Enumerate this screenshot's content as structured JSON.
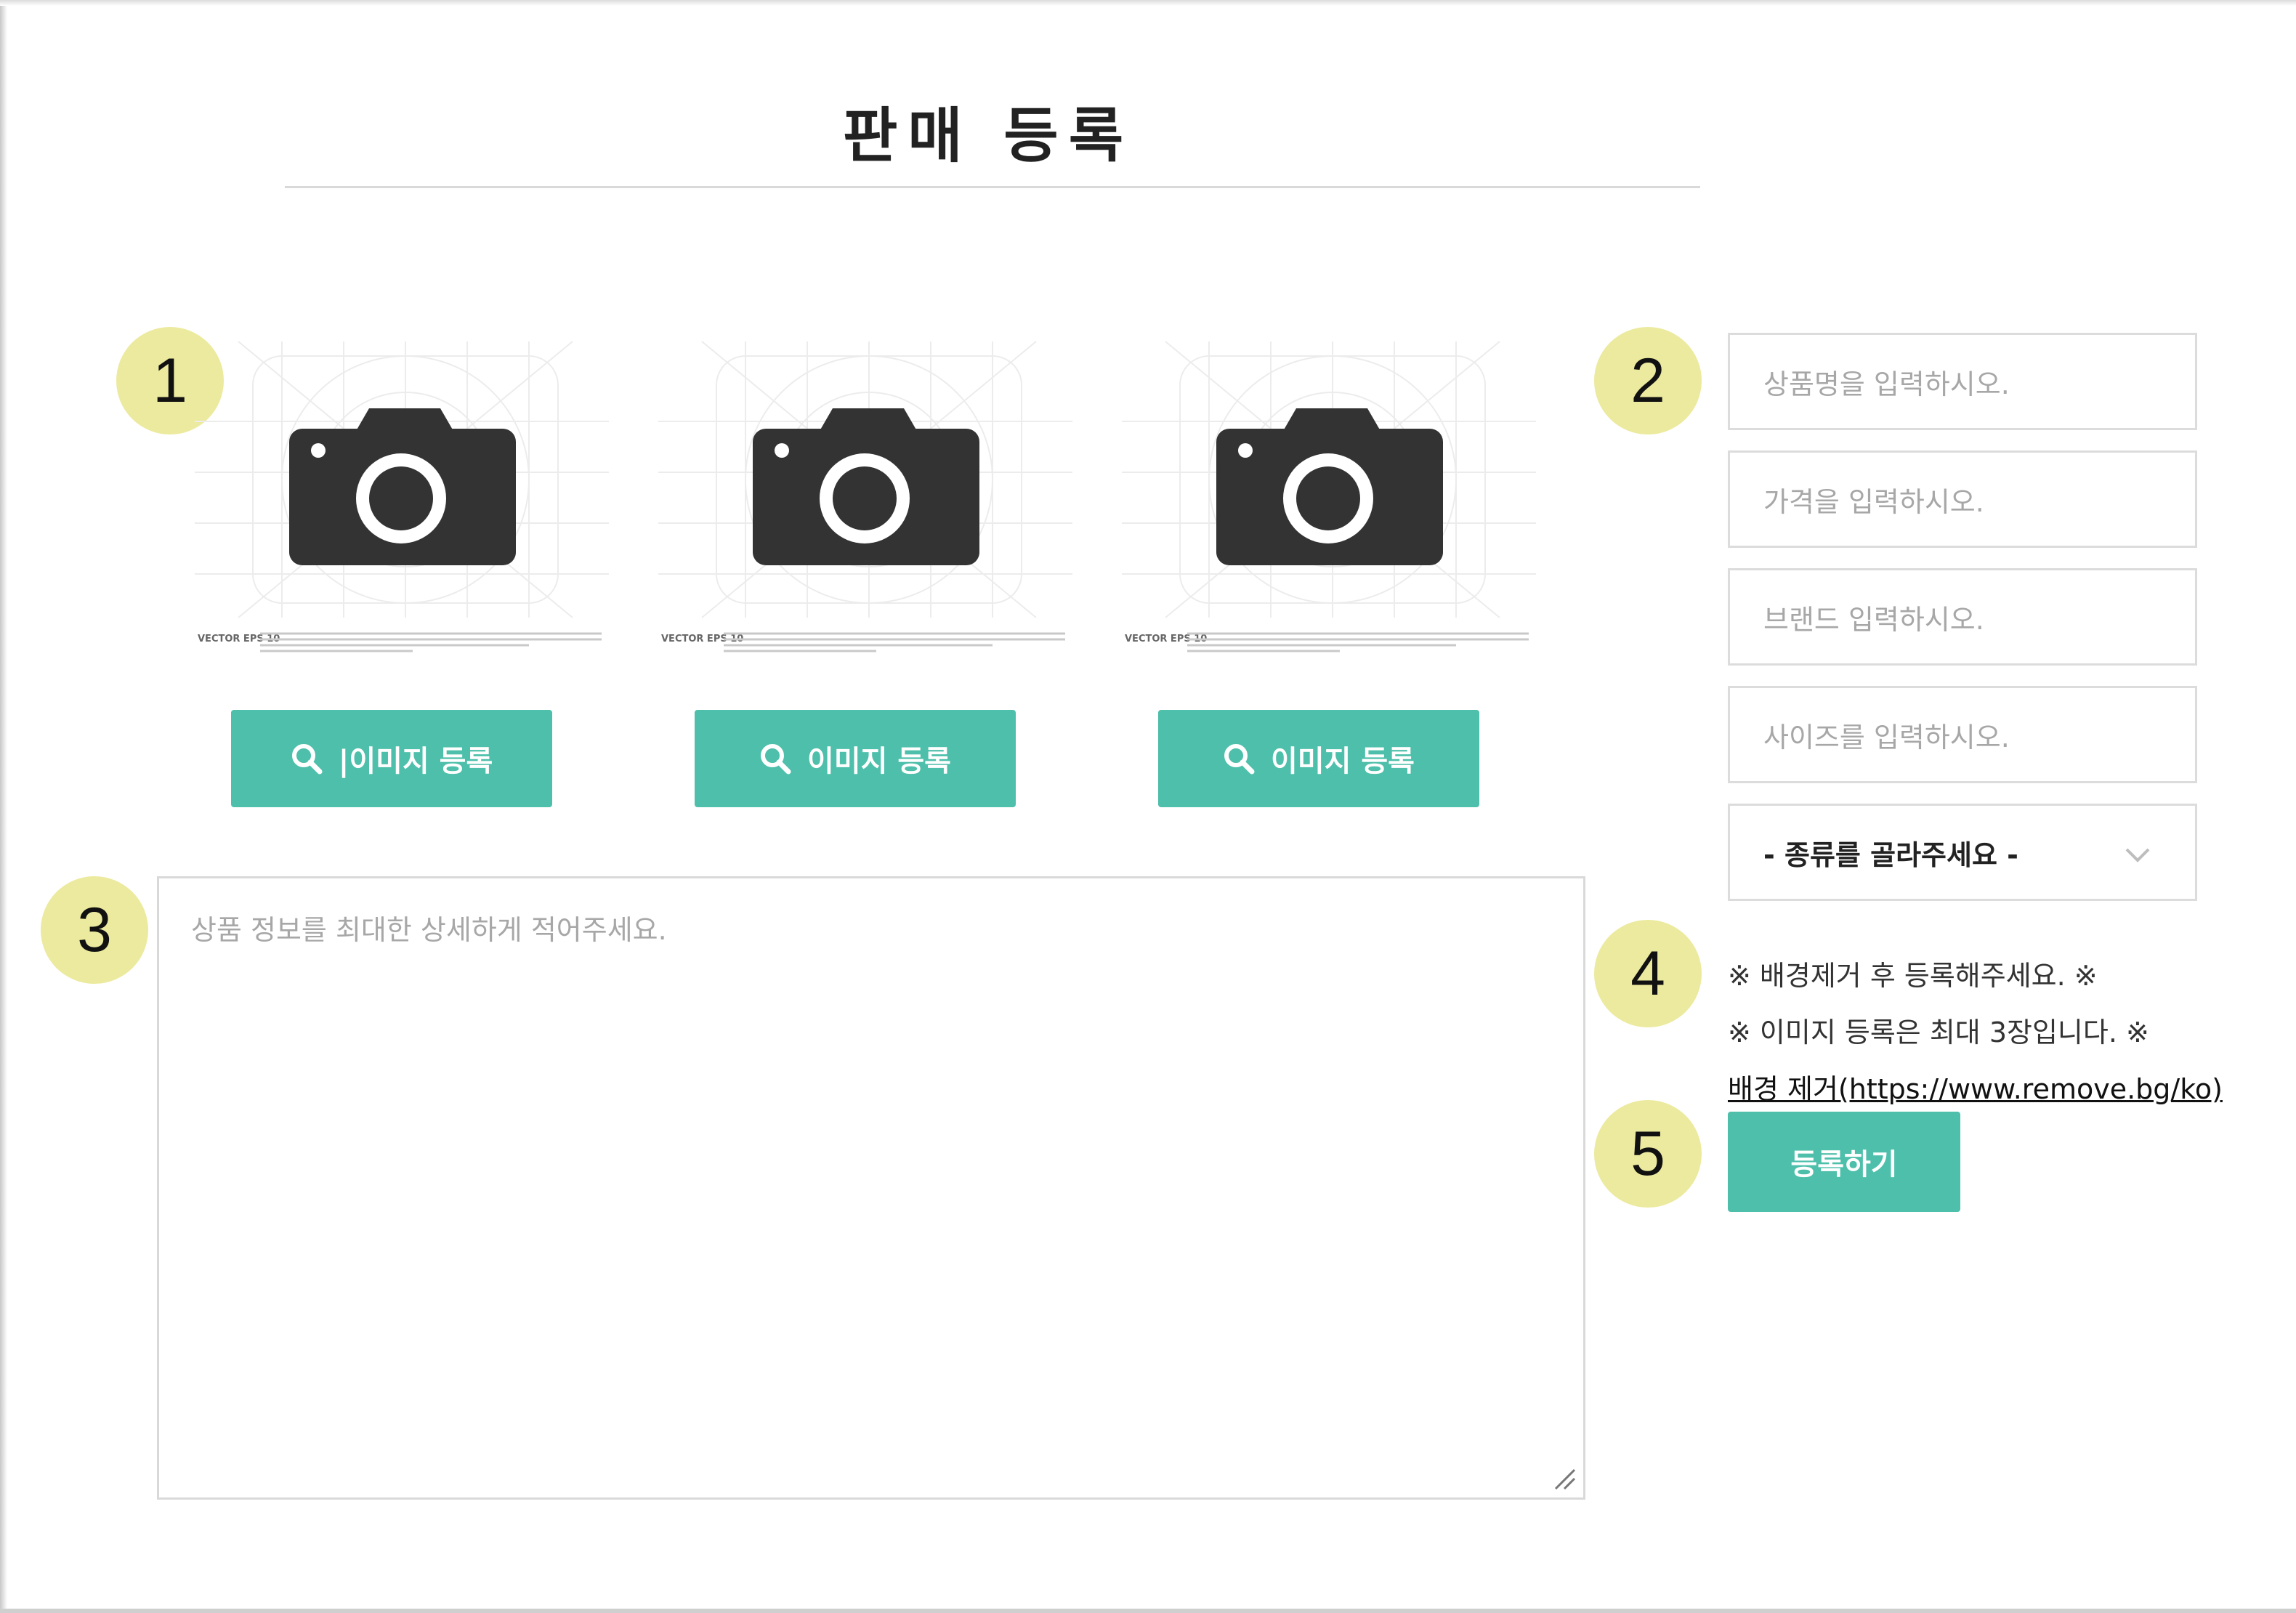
{
  "page": {
    "title": "판매 등록"
  },
  "annotations": [
    "1",
    "2",
    "3",
    "4",
    "5"
  ],
  "images": [
    {
      "button_label": "|이미지 등록",
      "stock_caption": "VECTOR EPS 10"
    },
    {
      "button_label": "이미지 등록",
      "stock_caption": "VECTOR EPS 10"
    },
    {
      "button_label": "이미지 등록",
      "stock_caption": "VECTOR EPS 10"
    }
  ],
  "form": {
    "product_name_placeholder": "상품명을 입력하시오.",
    "price_placeholder": "가격을 입력하시오.",
    "brand_placeholder": "브랜드 입력하시오.",
    "size_placeholder": "사이즈를 입력하시오.",
    "category_select": "- 종류를 골라주세요 -",
    "description_placeholder": "상품 정보를 최대한 상세하게 적어주세요."
  },
  "notes": {
    "bg_removal_notice": "※ 배경제거 후 등록해주세요. ※",
    "max_images_notice": "※ 이미지 등록은 최대 3장입니다. ※",
    "link_text": "배경 제거(https://www.remove.bg/ko)"
  },
  "actions": {
    "submit_label": "등록하기"
  },
  "colors": {
    "accent": "#4dbfaa",
    "marker": "#ecea9e",
    "icon": "#333333"
  },
  "icons": [
    "camera-icon",
    "search-icon",
    "chevron-down-icon",
    "resize-grip-icon"
  ]
}
